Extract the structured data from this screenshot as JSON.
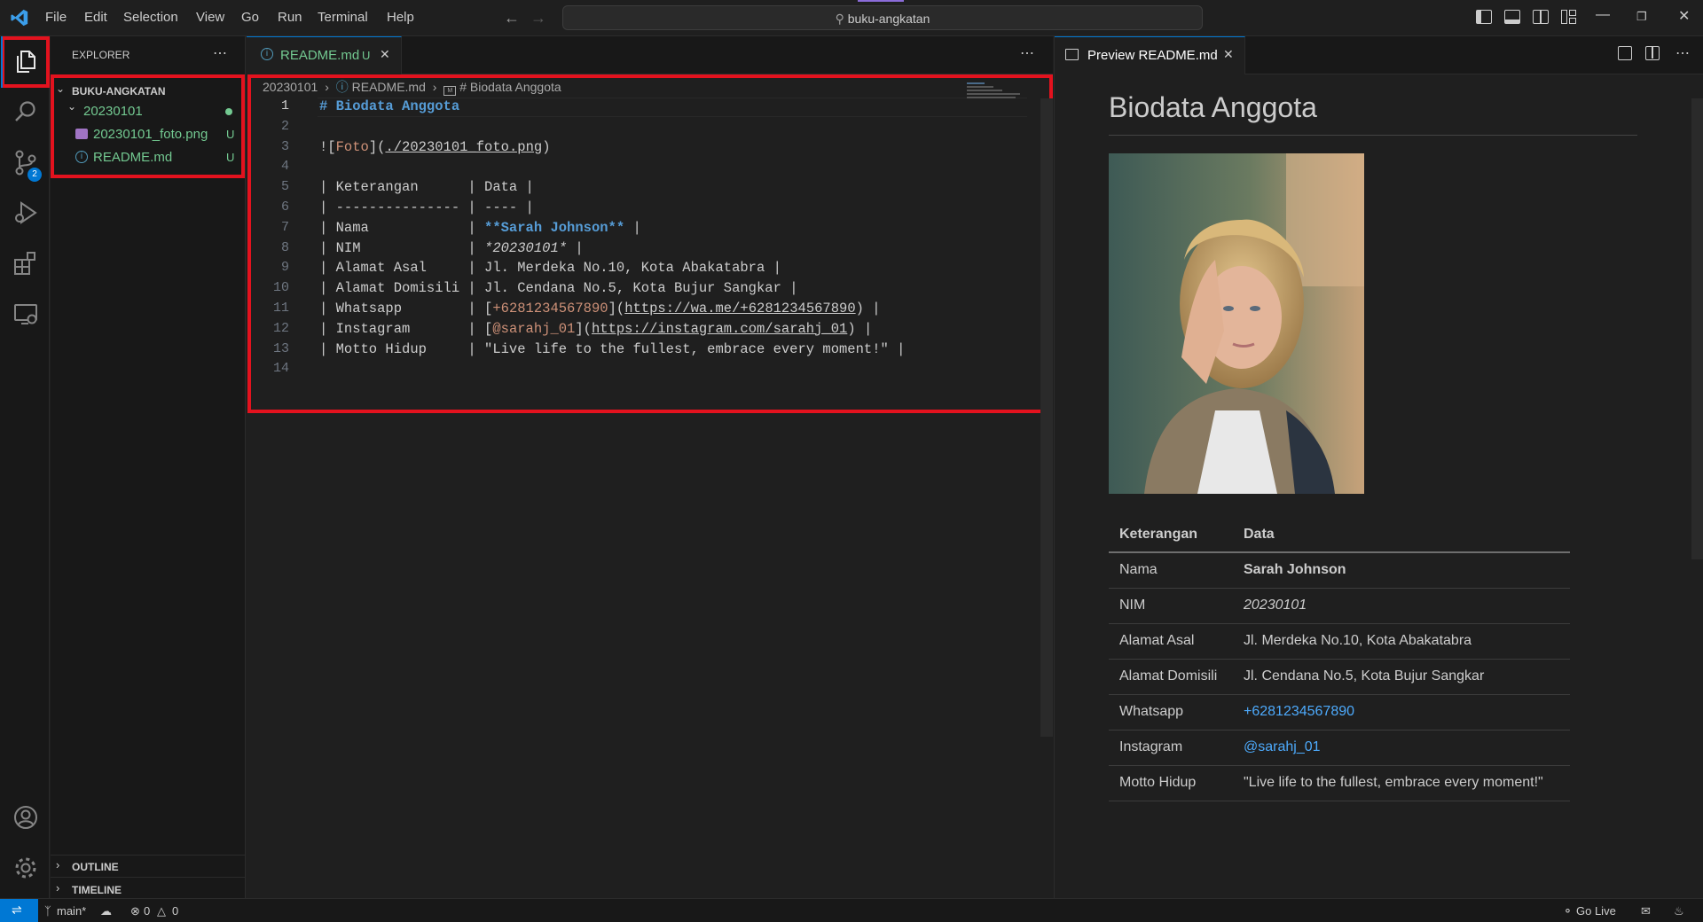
{
  "menu": [
    "File",
    "Edit",
    "Selection",
    "View",
    "Go",
    "Run",
    "Terminal",
    "Help"
  ],
  "command_center": "buku-angkatan",
  "sidebar": {
    "title": "EXPLORER",
    "folder": "BUKU-ANGKATAN",
    "subfolder": "20230101",
    "files": [
      {
        "name": "20230101_foto.png",
        "status": "U"
      },
      {
        "name": "README.md",
        "status": "U"
      }
    ],
    "outline": "OUTLINE",
    "timeline": "TIMELINE"
  },
  "source_control_badge": "2",
  "editor": {
    "tab_label": "README.md",
    "tab_status": "U",
    "breadcrumb": [
      "20230101",
      "README.md",
      "# Biodata Anggota"
    ],
    "line_numbers": [
      "1",
      "2",
      "3",
      "4",
      "5",
      "6",
      "7",
      "8",
      "9",
      "10",
      "11",
      "12",
      "13",
      "14"
    ]
  },
  "preview": {
    "tab_label": "Preview README.md",
    "heading": "Biodata Anggota",
    "table_headers": [
      "Keterangan",
      "Data"
    ],
    "rows": [
      {
        "label": "Nama",
        "value": "Sarah Johnson"
      },
      {
        "label": "NIM",
        "value": "20230101"
      },
      {
        "label": "Alamat Asal",
        "value": "Jl. Merdeka No.10, Kota Abakatabra"
      },
      {
        "label": "Alamat Domisili",
        "value": "Jl. Cendana No.5, Kota Bujur Sangkar"
      },
      {
        "label": "Whatsapp",
        "value": "+6281234567890"
      },
      {
        "label": "Instagram",
        "value": "@sarahj_01"
      },
      {
        "label": "Motto Hidup",
        "value": "\"Live life to the fullest, embrace every moment!\""
      }
    ]
  },
  "status": {
    "branch": "main*",
    "errors": "0",
    "warnings": "0",
    "go_live": "Go Live"
  },
  "colors": {
    "accent": "#0078d4",
    "highlight_box": "#e3121e",
    "untracked_file": "#73c991",
    "link": "#4daafc"
  }
}
